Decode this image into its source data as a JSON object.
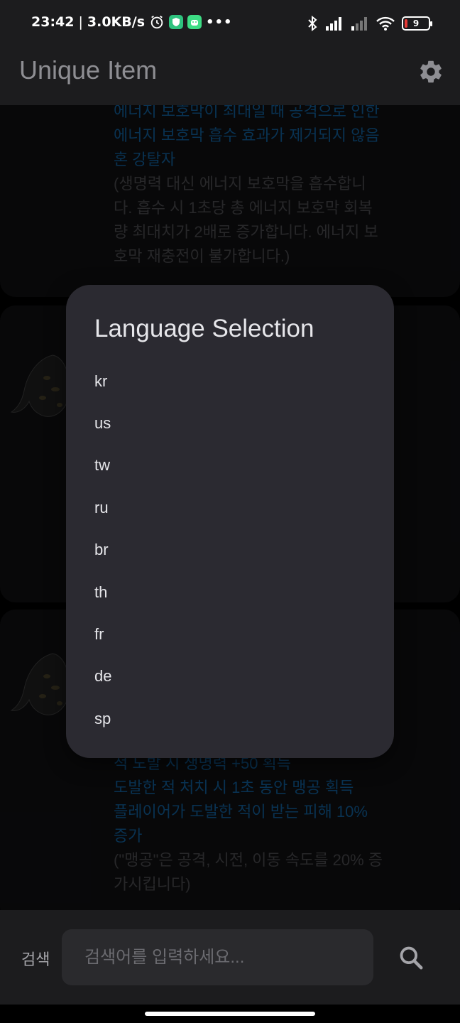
{
  "status_bar": {
    "time": "23:42",
    "network_speed": "3.0KB/s",
    "battery_level": "9",
    "icons": [
      "alarm-icon",
      "shield-app-icon",
      "android-app-icon",
      "more-dots-icon",
      "bluetooth-icon",
      "signal-icon",
      "signal-weak-icon",
      "wifi-icon",
      "battery-icon"
    ]
  },
  "app_bar": {
    "title": "Unique Item",
    "settings_icon": "gear-icon"
  },
  "cards": {
    "card1": {
      "lines_blue": [
        "에너지 보호막이 최대일 때 공격으로 인한",
        "에너지 보호막 흡수 효과가 제거되지 않음",
        "혼 강탈자"
      ],
      "lines_gray": [
        "(생명력 대신 에너지 보호막을 흡수합니",
        "다. 흡수 시 1초당 총 에너지 보호막 회복",
        "량 최대치가 2배로 증가합니다. 에너지 보",
        "호막 재충전이 불가합니다.)"
      ]
    },
    "card3": {
      "lines_blue": [
        "적 도발 시 생명력 +50 획득",
        "도발한 적 처치 시 1초 동안 맹공 획득",
        "플레이어가 도발한 적이 받는 피해 10%",
        "증가"
      ],
      "lines_gray": [
        "(\"맹공\"은 공격, 시전, 이동 속도를 20% 증",
        "가시킵니다)"
      ]
    }
  },
  "dialog": {
    "title": "Language Selection",
    "languages": [
      "kr",
      "us",
      "tw",
      "ru",
      "br",
      "th",
      "fr",
      "de",
      "sp"
    ]
  },
  "search": {
    "label": "검색",
    "placeholder": "검색어를 입력하세요...",
    "button_icon": "search-icon"
  },
  "colors": {
    "accent_blue": "#0e4e7e",
    "dialog_bg": "#2b2a31",
    "bar_bg": "#1c1c1e"
  }
}
